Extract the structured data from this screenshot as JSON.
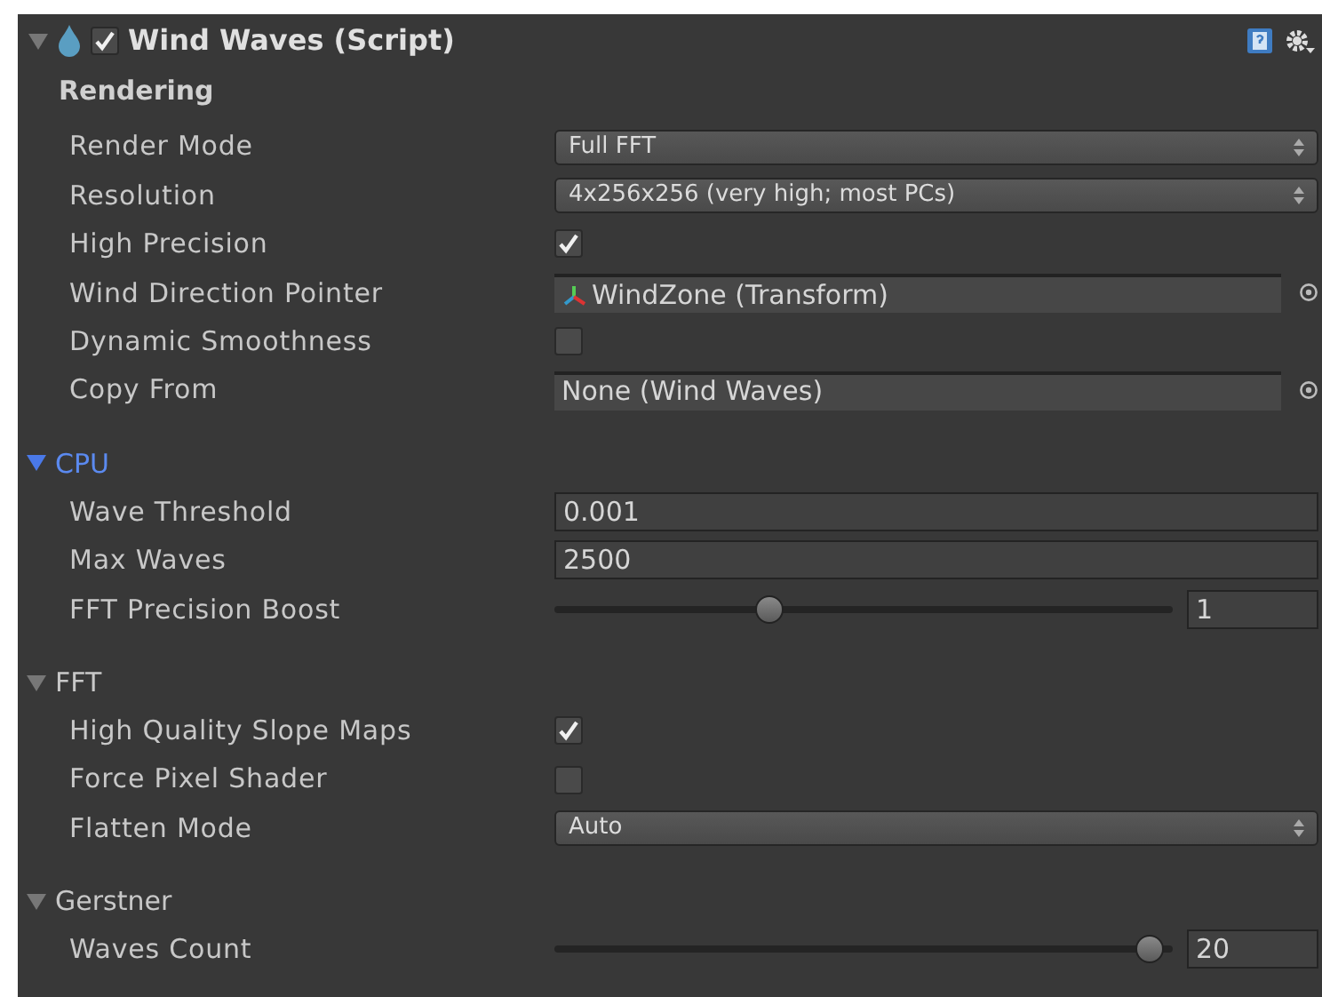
{
  "header": {
    "expanded": true,
    "enabled": true,
    "title": "Wind Waves (Script)"
  },
  "rendering": {
    "title": "Rendering",
    "rows": [
      {
        "kind": "dropdown",
        "label": "Render Mode",
        "value": "Full FFT"
      },
      {
        "kind": "dropdown",
        "label": "Resolution",
        "value": "4x256x256 (very high; most PCs)"
      },
      {
        "kind": "checkbox",
        "label": "High Precision",
        "checked": true
      },
      {
        "kind": "object",
        "label": "Wind Direction Pointer",
        "value": "WindZone (Transform)",
        "has_icon": true
      },
      {
        "kind": "checkbox",
        "label": "Dynamic Smoothness",
        "checked": false
      },
      {
        "kind": "object",
        "label": "Copy From",
        "value": "None (Wind Waves)",
        "has_icon": false
      }
    ]
  },
  "sections": [
    {
      "title": "CPU",
      "expanded": true,
      "focused": true,
      "rows": [
        {
          "kind": "number",
          "label": "Wave Threshold",
          "value": "0.001"
        },
        {
          "kind": "number",
          "label": "Max Waves",
          "value": "2500"
        },
        {
          "kind": "slider",
          "label": "FFT Precision Boost",
          "level": 0.34,
          "value": "1"
        }
      ]
    },
    {
      "title": "FFT",
      "expanded": true,
      "focused": false,
      "rows": [
        {
          "kind": "checkbox",
          "label": "High Quality Slope Maps",
          "checked": true
        },
        {
          "kind": "checkbox",
          "label": "Force Pixel Shader",
          "checked": false
        },
        {
          "kind": "dropdown",
          "label": "Flatten Mode",
          "value": "Auto"
        }
      ]
    },
    {
      "title": "Gerstner",
      "expanded": true,
      "focused": false,
      "rows": [
        {
          "kind": "slider",
          "label": "Waves Count",
          "level": 0.985,
          "value": "20"
        }
      ]
    }
  ]
}
